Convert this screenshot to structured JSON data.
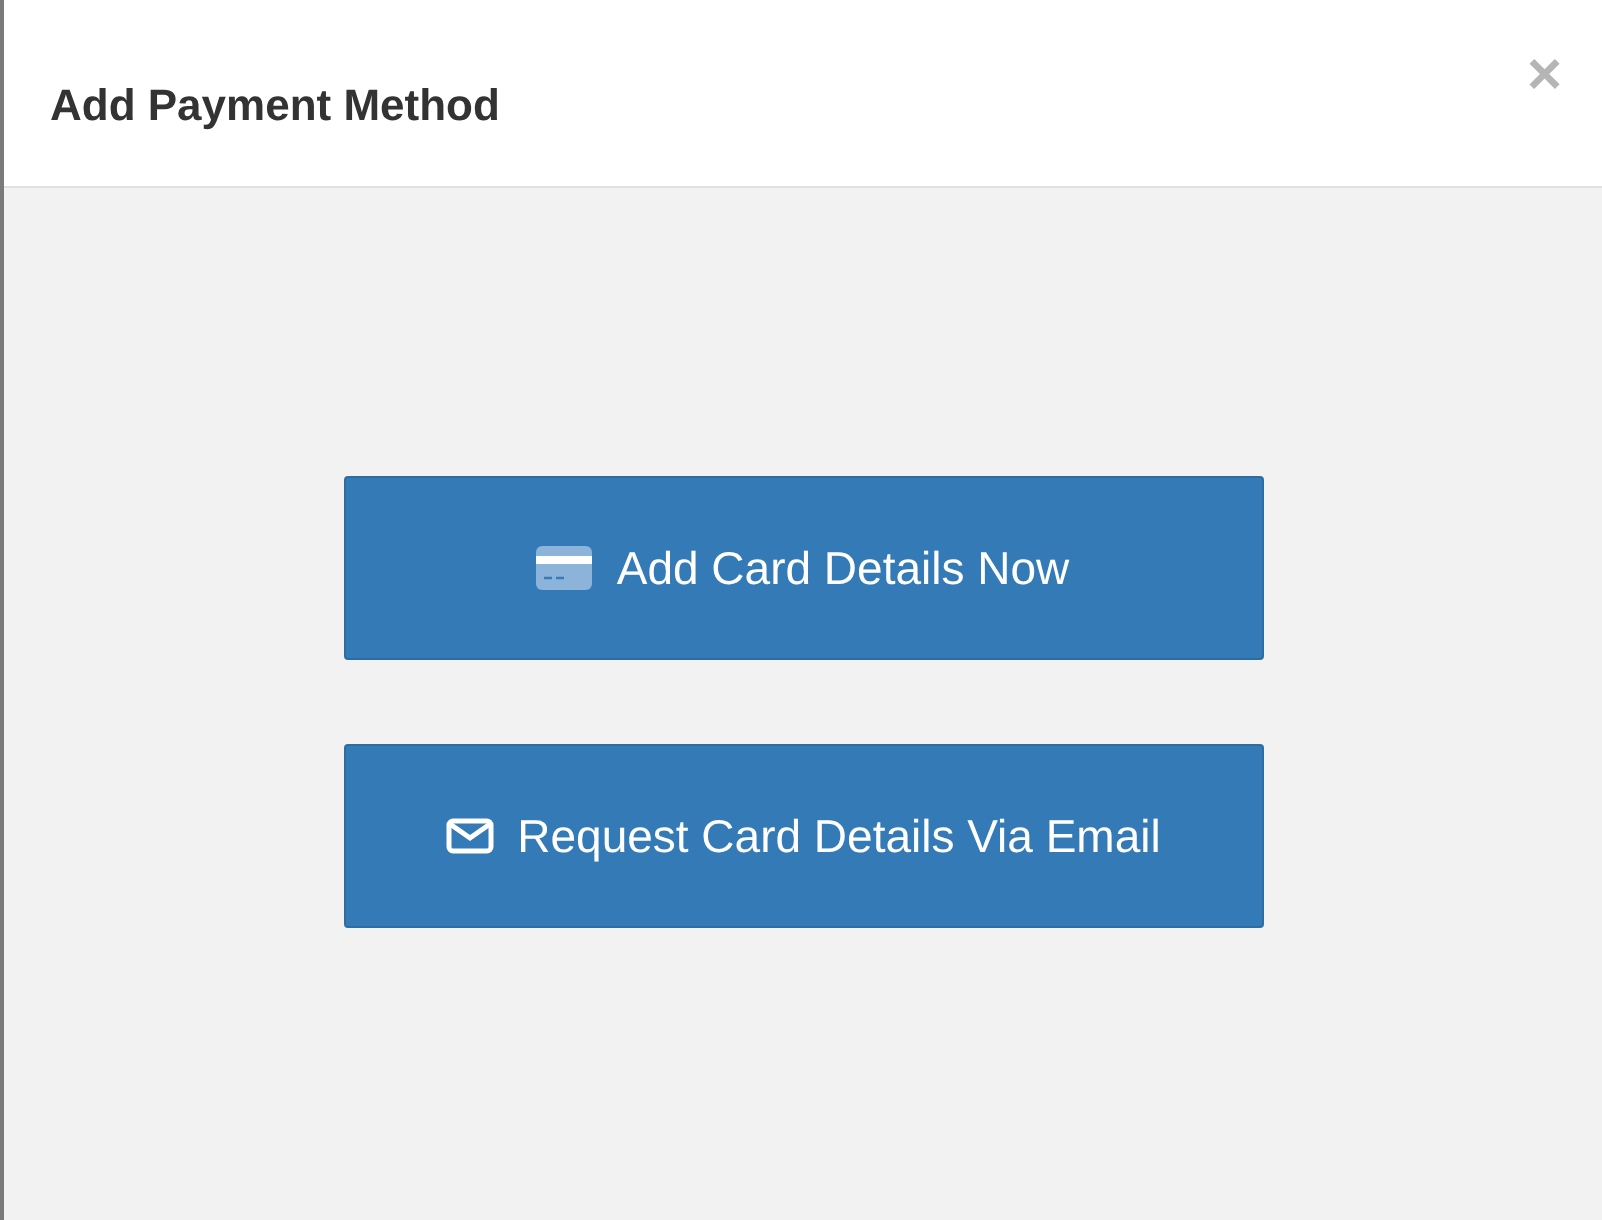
{
  "dialog": {
    "title": "Add Payment Method",
    "close": "×"
  },
  "actions": [
    {
      "label": "Add Card Details Now",
      "kind": "card"
    },
    {
      "label": "Request Card Details Via Email",
      "kind": "email"
    }
  ]
}
